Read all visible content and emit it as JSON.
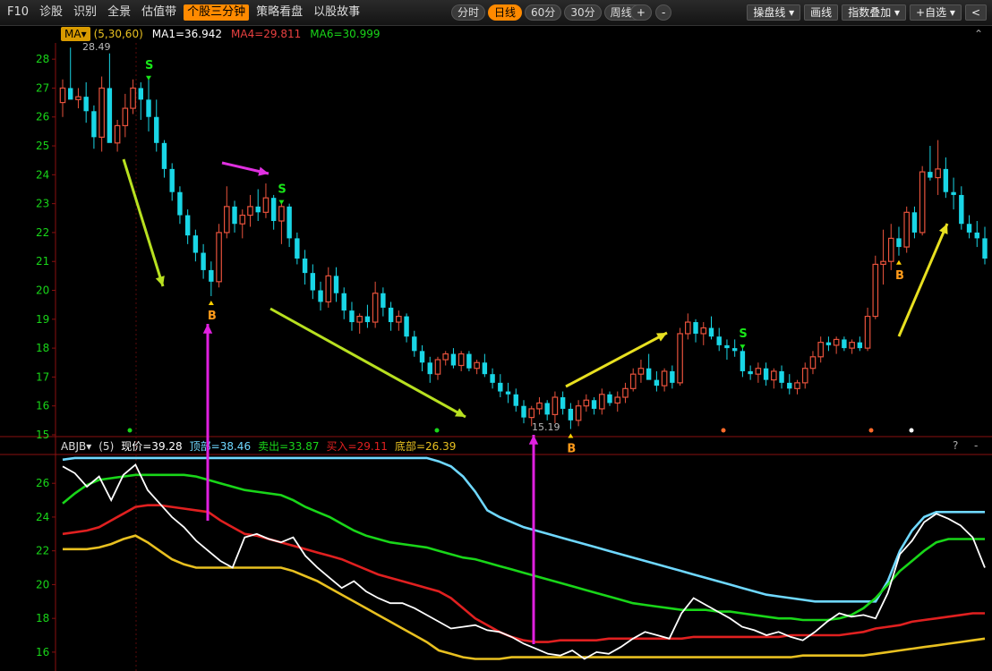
{
  "toolbar": {
    "left_items": [
      "F10",
      "诊股",
      "识别",
      "全景",
      "估值带",
      "个股三分钟",
      "策略看盘",
      "以股故事"
    ],
    "active_left": "个股三分钟",
    "periods": [
      "分时",
      "日线",
      "60分",
      "30分",
      "周线 ▾"
    ],
    "active_period": "日线",
    "zoom_in": "+",
    "zoom_out": "-",
    "right_buttons": [
      "操盘线 ▾",
      "画线",
      "指数叠加 ▾",
      "+自选 ▾",
      "<"
    ]
  },
  "main_panel": {
    "indicator_badge": "MA▾",
    "params": "(5,30,60)",
    "ma1": "MA1=36.942",
    "ma4": "MA4=29.811",
    "ma6": "MA6=30.999",
    "corner_icon": "⌃",
    "y_ticks": [
      "28",
      "27",
      "26",
      "25",
      "24",
      "23",
      "22",
      "21",
      "20",
      "19",
      "18",
      "17",
      "16",
      "15"
    ],
    "high_label": "28.49",
    "low_label": "15.19",
    "buy_marker": "B",
    "sell_marker": "S",
    "colors": {
      "up": "#e8523c",
      "down": "#19d6e6",
      "ma_badge": "#d89a00"
    }
  },
  "sub_panel": {
    "indicator": "ABJB▾",
    "param": "(5)",
    "now": "现价=39.28",
    "top": "顶部=38.46",
    "sell": "卖出=33.87",
    "buy": "买入=29.11",
    "bottom": "底部=26.39",
    "help_icon": "?",
    "close_icon": "-",
    "y_ticks": [
      "26",
      "24",
      "22",
      "20",
      "18",
      "16"
    ],
    "colors": {
      "now": "#ffffff",
      "top": "#6fd8ff",
      "sell": "#19d619",
      "buy": "#e02020",
      "bottom": "#e8c020"
    }
  },
  "chart_data": [
    {
      "type": "candlestick",
      "title": "",
      "ylim": [
        15,
        28.5
      ],
      "candles": [
        [
          26.5,
          27.3,
          26.0,
          27.0
        ],
        [
          27.0,
          28.4,
          26.8,
          26.6
        ],
        [
          26.6,
          27.0,
          26.3,
          26.7
        ],
        [
          26.7,
          27.2,
          25.8,
          26.2
        ],
        [
          26.2,
          26.4,
          24.9,
          25.3
        ],
        [
          25.3,
          27.4,
          24.8,
          27.0
        ],
        [
          27.0,
          28.2,
          26.2,
          25.1
        ],
        [
          25.1,
          25.9,
          24.8,
          25.7
        ],
        [
          25.7,
          26.8,
          25.3,
          26.3
        ],
        [
          26.3,
          27.3,
          26.1,
          27.0
        ],
        [
          27.0,
          27.2,
          25.9,
          26.6
        ],
        [
          26.6,
          27.3,
          25.5,
          26.0
        ],
        [
          26.0,
          26.6,
          24.8,
          25.1
        ],
        [
          25.1,
          25.2,
          23.9,
          24.2
        ],
        [
          24.2,
          24.4,
          23.1,
          23.4
        ],
        [
          23.4,
          23.6,
          22.3,
          22.6
        ],
        [
          22.6,
          22.8,
          21.6,
          21.9
        ],
        [
          21.9,
          22.1,
          21.0,
          21.3
        ],
        [
          21.3,
          21.6,
          20.4,
          20.7
        ],
        [
          20.7,
          21.0,
          19.8,
          20.3
        ],
        [
          20.3,
          22.3,
          20.1,
          22.0
        ],
        [
          22.0,
          23.6,
          21.8,
          22.9
        ],
        [
          22.9,
          23.1,
          22.0,
          22.3
        ],
        [
          22.3,
          22.8,
          21.8,
          22.6
        ],
        [
          22.6,
          23.3,
          22.2,
          22.9
        ],
        [
          22.9,
          23.5,
          22.4,
          22.7
        ],
        [
          22.7,
          23.7,
          22.5,
          23.2
        ],
        [
          23.2,
          23.3,
          22.1,
          22.4
        ],
        [
          22.4,
          23.0,
          21.6,
          22.9
        ],
        [
          22.9,
          23.0,
          21.5,
          21.8
        ],
        [
          21.8,
          22.0,
          20.9,
          21.1
        ],
        [
          21.1,
          21.4,
          20.2,
          20.6
        ],
        [
          20.6,
          20.9,
          19.7,
          20.0
        ],
        [
          20.0,
          20.3,
          19.3,
          19.6
        ],
        [
          19.6,
          20.8,
          19.4,
          20.5
        ],
        [
          20.5,
          20.8,
          19.6,
          19.9
        ],
        [
          19.9,
          20.1,
          19.0,
          19.3
        ],
        [
          19.3,
          19.6,
          18.6,
          18.9
        ],
        [
          18.9,
          19.2,
          18.5,
          19.1
        ],
        [
          19.1,
          19.5,
          18.7,
          18.9
        ],
        [
          18.9,
          20.3,
          18.7,
          19.9
        ],
        [
          19.9,
          20.1,
          19.1,
          19.4
        ],
        [
          19.4,
          19.6,
          18.6,
          18.9
        ],
        [
          18.9,
          19.3,
          18.6,
          19.1
        ],
        [
          19.1,
          19.2,
          18.2,
          18.4
        ],
        [
          18.4,
          18.6,
          17.7,
          17.9
        ],
        [
          17.9,
          18.1,
          17.2,
          17.5
        ],
        [
          17.5,
          17.7,
          16.8,
          17.1
        ],
        [
          17.1,
          17.7,
          16.9,
          17.6
        ],
        [
          17.6,
          17.9,
          17.4,
          17.8
        ],
        [
          17.8,
          18.0,
          17.3,
          17.4
        ],
        [
          17.4,
          17.9,
          17.2,
          17.8
        ],
        [
          17.8,
          17.9,
          17.2,
          17.3
        ],
        [
          17.3,
          17.6,
          17.1,
          17.5
        ],
        [
          17.5,
          17.8,
          17.0,
          17.1
        ],
        [
          17.1,
          17.3,
          16.6,
          16.8
        ],
        [
          16.8,
          17.1,
          16.3,
          16.5
        ],
        [
          16.5,
          16.8,
          16.1,
          16.4
        ],
        [
          16.4,
          16.6,
          15.8,
          16.0
        ],
        [
          16.0,
          16.2,
          15.4,
          15.6
        ],
        [
          15.6,
          16.0,
          15.3,
          15.9
        ],
        [
          15.9,
          16.3,
          15.7,
          16.1
        ],
        [
          16.1,
          16.2,
          15.5,
          15.7
        ],
        [
          15.7,
          16.5,
          15.4,
          16.3
        ],
        [
          16.3,
          16.5,
          15.7,
          15.9
        ],
        [
          15.9,
          16.1,
          15.2,
          15.5
        ],
        [
          15.5,
          16.2,
          15.3,
          16.0
        ],
        [
          16.0,
          16.4,
          15.8,
          16.2
        ],
        [
          16.2,
          16.3,
          15.7,
          15.9
        ],
        [
          15.9,
          16.6,
          15.7,
          16.4
        ],
        [
          16.4,
          16.5,
          16.0,
          16.1
        ],
        [
          16.1,
          16.5,
          15.8,
          16.3
        ],
        [
          16.3,
          16.8,
          16.1,
          16.6
        ],
        [
          16.6,
          17.3,
          16.5,
          17.1
        ],
        [
          17.1,
          17.6,
          16.8,
          17.3
        ],
        [
          17.3,
          17.8,
          17.0,
          16.9
        ],
        [
          16.9,
          17.2,
          16.5,
          16.7
        ],
        [
          16.7,
          17.3,
          16.5,
          17.2
        ],
        [
          17.2,
          17.4,
          16.6,
          16.8
        ],
        [
          16.8,
          18.7,
          16.7,
          18.5
        ],
        [
          18.5,
          19.2,
          18.3,
          18.9
        ],
        [
          18.9,
          19.0,
          18.2,
          18.5
        ],
        [
          18.5,
          18.9,
          18.1,
          18.7
        ],
        [
          18.7,
          19.1,
          18.3,
          18.4
        ],
        [
          18.4,
          18.7,
          17.9,
          18.1
        ],
        [
          18.1,
          18.3,
          17.6,
          18.0
        ],
        [
          18.0,
          18.3,
          17.7,
          17.9
        ],
        [
          17.9,
          18.0,
          17.0,
          17.2
        ],
        [
          17.2,
          17.4,
          16.9,
          17.1
        ],
        [
          17.1,
          17.5,
          16.8,
          17.3
        ],
        [
          17.3,
          17.5,
          16.7,
          16.9
        ],
        [
          16.9,
          17.3,
          16.6,
          17.2
        ],
        [
          17.2,
          17.4,
          16.6,
          16.8
        ],
        [
          16.8,
          17.1,
          16.4,
          16.6
        ],
        [
          16.6,
          16.9,
          16.4,
          16.8
        ],
        [
          16.8,
          17.5,
          16.6,
          17.3
        ],
        [
          17.3,
          17.9,
          17.1,
          17.7
        ],
        [
          17.7,
          18.4,
          17.5,
          18.2
        ],
        [
          18.2,
          18.4,
          17.9,
          18.1
        ],
        [
          18.1,
          18.4,
          17.8,
          18.3
        ],
        [
          18.3,
          18.4,
          17.9,
          18.0
        ],
        [
          18.0,
          18.3,
          17.8,
          18.2
        ],
        [
          18.2,
          18.4,
          17.9,
          18.0
        ],
        [
          18.0,
          19.4,
          17.9,
          19.1
        ],
        [
          19.1,
          21.2,
          19.0,
          20.9
        ],
        [
          20.9,
          22.1,
          20.2,
          21.0
        ],
        [
          21.0,
          22.3,
          20.7,
          21.8
        ],
        [
          21.8,
          22.2,
          21.2,
          21.5
        ],
        [
          21.5,
          22.9,
          21.3,
          22.7
        ],
        [
          22.7,
          22.9,
          21.8,
          22.0
        ],
        [
          22.0,
          24.3,
          21.9,
          24.1
        ],
        [
          24.1,
          25.0,
          23.8,
          23.9
        ],
        [
          23.9,
          25.2,
          23.3,
          24.2
        ],
        [
          24.2,
          24.6,
          23.2,
          23.4
        ],
        [
          23.4,
          23.9,
          22.8,
          23.3
        ],
        [
          23.3,
          23.6,
          22.1,
          22.3
        ],
        [
          22.3,
          22.6,
          21.8,
          22.0
        ],
        [
          22.0,
          22.4,
          21.5,
          21.8
        ],
        [
          21.8,
          22.2,
          20.9,
          21.1
        ]
      ],
      "series": [
        {
          "name": "现价",
          "values": [
            27.0,
            26.6,
            25.8,
            26.4,
            25.0,
            26.5,
            27.1,
            25.6,
            24.8,
            24.0,
            23.4,
            22.6,
            22.0,
            21.4,
            21.0,
            22.8,
            23.0,
            22.7,
            22.5,
            22.8,
            21.7,
            21.0,
            20.4,
            19.8,
            20.2,
            19.6,
            19.2,
            18.9,
            18.9,
            18.6,
            18.2,
            17.8,
            17.4,
            17.5,
            17.6,
            17.3,
            17.2,
            16.9,
            16.5,
            16.2,
            15.9,
            15.8,
            16.1,
            15.6,
            16.0,
            15.9,
            16.3,
            16.8,
            17.2,
            17.0,
            16.8,
            18.3,
            19.2,
            18.8,
            18.4,
            18.0,
            17.5,
            17.3,
            17.0,
            17.2,
            16.9,
            16.7,
            17.2,
            17.8,
            18.3,
            18.1,
            18.2,
            18.0,
            19.5,
            21.8,
            22.6,
            23.7,
            24.2,
            23.9,
            23.5,
            22.8,
            21.0
          ]
        },
        {
          "name": "顶部",
          "values": [
            27.4,
            27.5,
            27.5,
            27.5,
            27.5,
            27.5,
            27.5,
            27.5,
            27.5,
            27.5,
            27.5,
            27.5,
            27.5,
            27.5,
            27.5,
            27.5,
            27.5,
            27.5,
            27.5,
            27.5,
            27.5,
            27.5,
            27.5,
            27.5,
            27.5,
            27.5,
            27.5,
            27.5,
            27.5,
            27.5,
            27.5,
            27.3,
            27.0,
            26.4,
            25.5,
            24.4,
            24.0,
            23.7,
            23.4,
            23.2,
            23.0,
            22.8,
            22.6,
            22.4,
            22.2,
            22.0,
            21.8,
            21.6,
            21.4,
            21.2,
            21.0,
            20.8,
            20.6,
            20.4,
            20.2,
            20.0,
            19.8,
            19.6,
            19.4,
            19.3,
            19.2,
            19.1,
            19.0,
            19.0,
            19.0,
            19.0,
            19.0,
            19.0,
            20.2,
            22.0,
            23.2,
            24.0,
            24.3,
            24.3,
            24.3,
            24.3,
            24.3
          ]
        },
        {
          "name": "卖出",
          "values": [
            24.8,
            25.4,
            25.9,
            26.2,
            26.3,
            26.4,
            26.5,
            26.5,
            26.5,
            26.5,
            26.5,
            26.4,
            26.2,
            26.0,
            25.8,
            25.6,
            25.5,
            25.4,
            25.3,
            25.0,
            24.6,
            24.3,
            24.0,
            23.6,
            23.2,
            22.9,
            22.7,
            22.5,
            22.4,
            22.3,
            22.2,
            22.0,
            21.8,
            21.6,
            21.5,
            21.3,
            21.1,
            20.9,
            20.7,
            20.5,
            20.3,
            20.1,
            19.9,
            19.7,
            19.5,
            19.3,
            19.1,
            18.9,
            18.8,
            18.7,
            18.6,
            18.5,
            18.5,
            18.5,
            18.4,
            18.4,
            18.3,
            18.2,
            18.1,
            18.0,
            18.0,
            17.9,
            17.9,
            17.9,
            18.0,
            18.2,
            18.6,
            19.2,
            20.0,
            20.8,
            21.4,
            22.0,
            22.5,
            22.7,
            22.7,
            22.7,
            22.7
          ]
        },
        {
          "name": "买入",
          "values": [
            23.0,
            23.1,
            23.2,
            23.4,
            23.8,
            24.2,
            24.6,
            24.7,
            24.7,
            24.6,
            24.5,
            24.4,
            24.3,
            23.8,
            23.4,
            23.0,
            22.9,
            22.7,
            22.5,
            22.3,
            22.1,
            21.9,
            21.7,
            21.5,
            21.2,
            20.9,
            20.6,
            20.4,
            20.2,
            20.0,
            19.8,
            19.6,
            19.2,
            18.6,
            18.0,
            17.6,
            17.2,
            16.9,
            16.7,
            16.6,
            16.6,
            16.7,
            16.7,
            16.7,
            16.7,
            16.8,
            16.8,
            16.8,
            16.8,
            16.8,
            16.8,
            16.8,
            16.9,
            16.9,
            16.9,
            16.9,
            16.9,
            16.9,
            16.9,
            16.9,
            17.0,
            17.0,
            17.0,
            17.0,
            17.0,
            17.1,
            17.2,
            17.4,
            17.5,
            17.6,
            17.8,
            17.9,
            18.0,
            18.1,
            18.2,
            18.3,
            18.3
          ]
        },
        {
          "name": "底部",
          "values": [
            22.1,
            22.1,
            22.1,
            22.2,
            22.4,
            22.7,
            22.9,
            22.5,
            22.0,
            21.5,
            21.2,
            21.0,
            21.0,
            21.0,
            21.0,
            21.0,
            21.0,
            21.0,
            21.0,
            20.8,
            20.5,
            20.2,
            19.8,
            19.4,
            19.0,
            18.6,
            18.2,
            17.8,
            17.4,
            17.0,
            16.6,
            16.1,
            15.9,
            15.7,
            15.6,
            15.6,
            15.6,
            15.7,
            15.7,
            15.7,
            15.7,
            15.7,
            15.7,
            15.7,
            15.7,
            15.7,
            15.7,
            15.7,
            15.7,
            15.7,
            15.7,
            15.7,
            15.7,
            15.7,
            15.7,
            15.7,
            15.7,
            15.7,
            15.7,
            15.7,
            15.7,
            15.8,
            15.8,
            15.8,
            15.8,
            15.8,
            15.8,
            15.9,
            16.0,
            16.1,
            16.2,
            16.3,
            16.4,
            16.5,
            16.6,
            16.7,
            16.8
          ]
        }
      ]
    }
  ]
}
